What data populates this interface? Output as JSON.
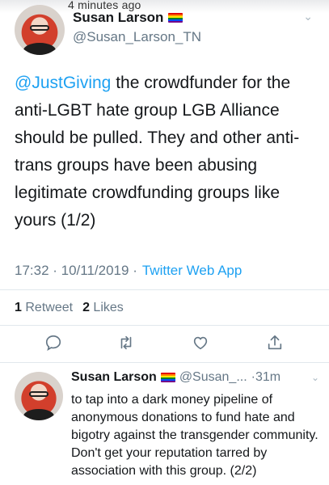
{
  "story": {
    "time_ago": "4 minutes ago"
  },
  "main_tweet": {
    "display_name": "Susan Larson",
    "flag_icon": "rainbow-flag-emoji",
    "handle": "@Susan_Larson_TN",
    "mention": "@JustGiving",
    "body": " the crowdfunder for the anti-LGBT hate group LGB Alliance should be pulled. They and other anti-trans groups have been abusing legitimate crowdfunding groups like yours (1/2)",
    "timestamp": "17:32 · 10/11/2019 ·",
    "source": "Twitter Web App",
    "retweet_count": "1",
    "retweet_label": "Retweet",
    "like_count": "2",
    "like_label": "Likes"
  },
  "actions": [
    "reply-icon",
    "retweet-icon",
    "like-icon",
    "share-icon"
  ],
  "reply_tweet": {
    "display_name": "Susan Larson",
    "flag_icon": "rainbow-flag-emoji",
    "handle": "@Susan_...",
    "time": "·31m",
    "body": "to tap into a dark money pipeline of anonymous donations to fund hate and bigotry against the transgender community. Don't get your reputation tarred by association with this group. (2/2)"
  },
  "colors": {
    "link": "#1da1f2",
    "muted": "#657786",
    "text": "#14171a",
    "divider": "#e1e8ed"
  }
}
